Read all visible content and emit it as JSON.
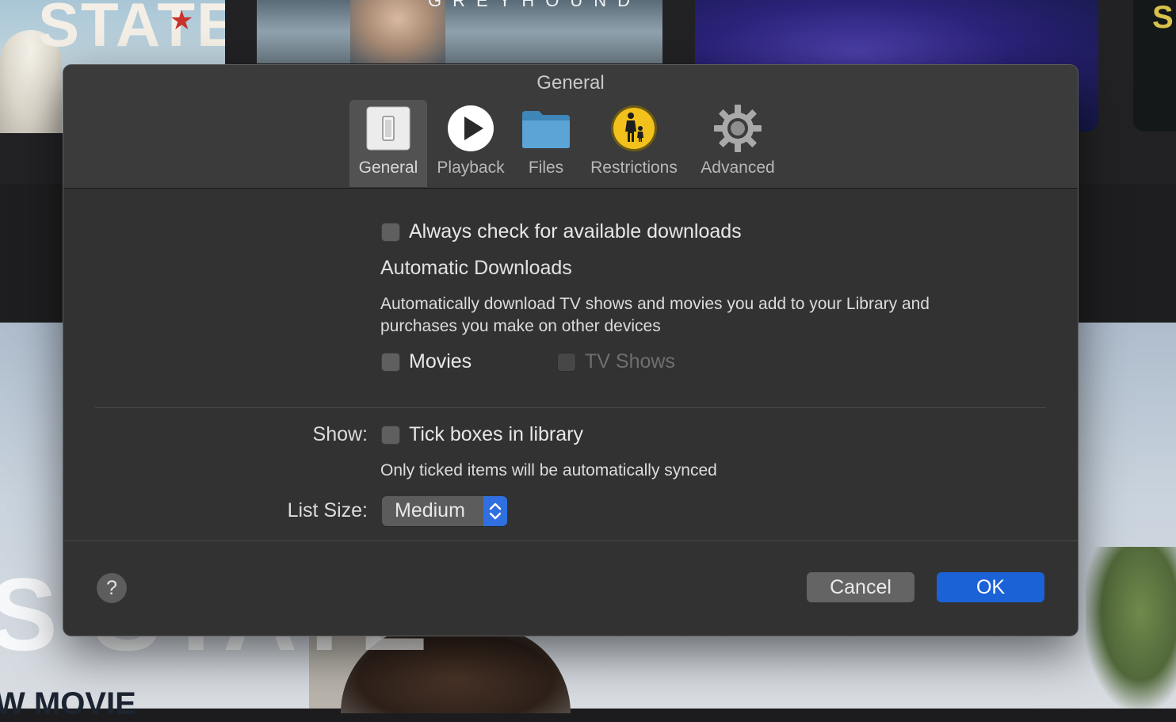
{
  "background": {
    "poster_1_title": "STATE",
    "poster_2_title": "GREYHOUND",
    "hero_title": "S STATE",
    "hero_subtitle": "W MOVIE"
  },
  "dialog": {
    "title": "General",
    "tabs": [
      {
        "label": "General",
        "icon": "general-switch-icon",
        "selected": true
      },
      {
        "label": "Playback",
        "icon": "play-icon",
        "selected": false
      },
      {
        "label": "Files",
        "icon": "folder-icon",
        "selected": false
      },
      {
        "label": "Restrictions",
        "icon": "parental-controls-icon",
        "selected": false
      },
      {
        "label": "Advanced",
        "icon": "gear-icon",
        "selected": false
      }
    ],
    "always_check": {
      "label": "Always check for available downloads",
      "checked": false
    },
    "automatic_downloads": {
      "heading": "Automatic Downloads",
      "description_line1": "Automatically download TV shows and movies you add to your Library and",
      "description_line2": "purchases you make on other devices",
      "movies": {
        "label": "Movies",
        "checked": false
      },
      "tv_shows": {
        "label": "TV Shows",
        "checked": false,
        "disabled": true
      }
    },
    "show": {
      "label": "Show:",
      "tick_boxes": {
        "label": "Tick boxes in library",
        "checked": false
      },
      "note": "Only ticked items will be automatically synced"
    },
    "list_size": {
      "label": "List Size:",
      "value": "Medium"
    },
    "buttons": {
      "help": "?",
      "cancel": "Cancel",
      "ok": "OK"
    },
    "colors": {
      "accent": "#1b62d6",
      "panel": "#323232",
      "toolbar": "#3b3b3b"
    }
  }
}
